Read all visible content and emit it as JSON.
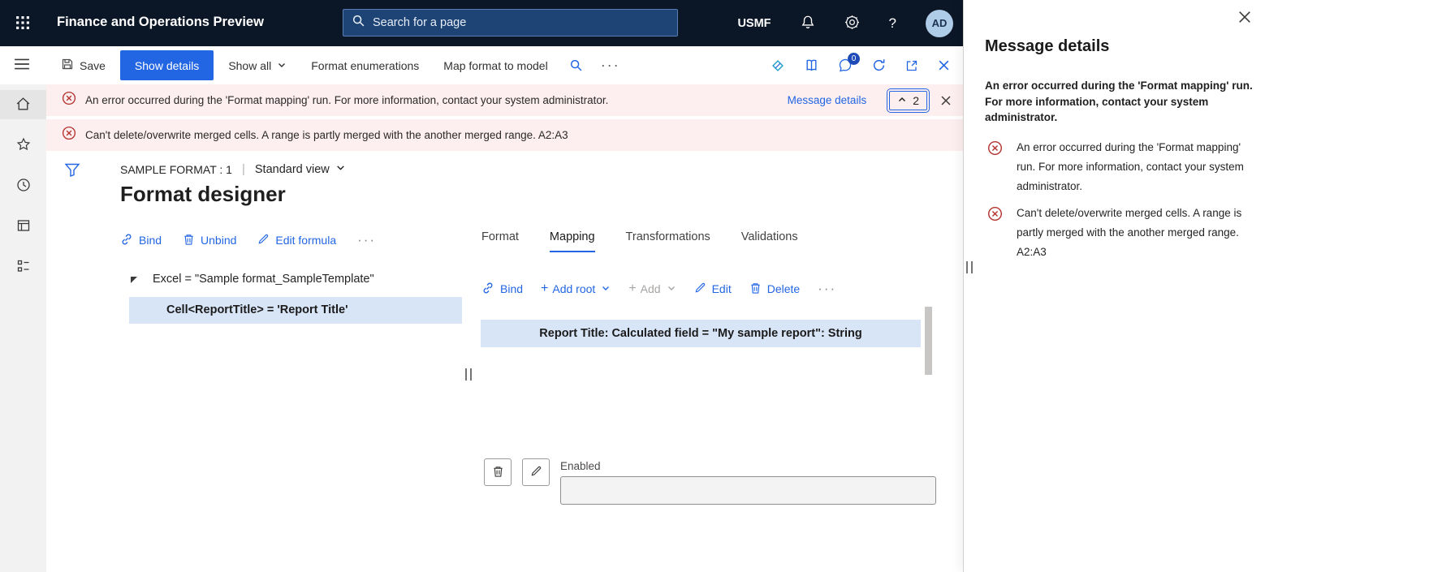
{
  "header": {
    "app_title": "Finance and Operations Preview",
    "search_placeholder": "Search for a page",
    "company": "USMF",
    "avatar_initials": "AD"
  },
  "icons": {
    "more_ellipsis": "···",
    "help_glyph": "?",
    "plus_glyph": "+"
  },
  "action_bar": {
    "save_label": "Save",
    "show_details_label": "Show details",
    "show_all_label": "Show all",
    "format_enumerations_label": "Format enumerations",
    "map_format_to_model_label": "Map format to model",
    "feedback_badge_count": "0"
  },
  "alerts": {
    "items": [
      "An error occurred during the 'Format mapping' run. For more information, contact your system administrator.",
      "Can't delete/overwrite merged cells. A range is partly merged with the another merged range. A2:A3"
    ],
    "message_details_link": "Message details",
    "collapse_count": "2"
  },
  "page": {
    "record_caption": "SAMPLE FORMAT : 1",
    "separator": "|",
    "view_selector": "Standard view",
    "title": "Format designer"
  },
  "format_pane": {
    "bind_label": "Bind",
    "unbind_label": "Unbind",
    "edit_formula_label": "Edit formula",
    "tree_root": "Excel = \"Sample format_SampleTemplate\"",
    "tree_selected": "Cell<ReportTitle> = 'Report Title'"
  },
  "mapping_pane": {
    "tabs": [
      "Format",
      "Mapping",
      "Transformations",
      "Validations"
    ],
    "active_tab": "Mapping",
    "bind_label": "Bind",
    "add_root_label": "Add root",
    "add_label": "Add",
    "edit_label": "Edit",
    "delete_label": "Delete",
    "selected_row": "Report Title: Calculated field = \"My sample report\": String",
    "enabled_label": "Enabled"
  },
  "message_panel": {
    "title": "Message details",
    "summary": "An error occurred during the 'Format mapping' run. For more information, contact your system administrator.",
    "items": [
      "An error occurred during the 'Format mapping' run. For more information, contact your system administrator.",
      "Can't delete/overwrite merged cells. A range is partly merged with the another merged range. A2:A3"
    ]
  },
  "colors": {
    "accent": "#2266e3",
    "error": "#b3332e",
    "selection": "#d8e5f7",
    "header_bg": "#0b1626",
    "alert_bg": "#fdeef0"
  }
}
